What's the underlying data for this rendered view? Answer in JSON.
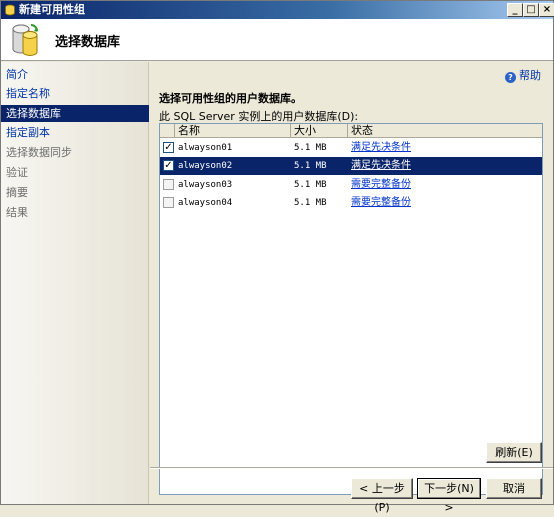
{
  "window": {
    "title": "新建可用性组"
  },
  "header": {
    "title": "选择数据库"
  },
  "nav": {
    "items": [
      {
        "label": "简介",
        "state": "link"
      },
      {
        "label": "指定名称",
        "state": "link"
      },
      {
        "label": "选择数据库",
        "state": "active"
      },
      {
        "label": "指定副本",
        "state": "link"
      },
      {
        "label": "选择数据同步",
        "state": "dim"
      },
      {
        "label": "验证",
        "state": "dim"
      },
      {
        "label": "摘要",
        "state": "dim"
      },
      {
        "label": "结果",
        "state": "dim"
      }
    ]
  },
  "main": {
    "help_label": "帮助",
    "section_title": "选择可用性组的用户数据库。",
    "list_label": "此 SQL Server 实例上的用户数据库(D):",
    "columns": {
      "name": "名称",
      "size": "大小",
      "status": "状态"
    },
    "rows": [
      {
        "name": "alwayson01",
        "size": "5.1 MB",
        "status": "满足先决条件",
        "checked": true,
        "selected": false
      },
      {
        "name": "alwayson02",
        "size": "5.1 MB",
        "status": "满足先决条件",
        "checked": true,
        "selected": true
      },
      {
        "name": "alwayson03",
        "size": "5.1 MB",
        "status": "需要完整备份",
        "checked": false,
        "selected": false
      },
      {
        "name": "alwayson04",
        "size": "5.1 MB",
        "status": "需要完整备份",
        "checked": false,
        "selected": false
      }
    ]
  },
  "buttons": {
    "refresh": "刷新(E)",
    "back": "< 上一步(P)",
    "next": "下一步(N) >",
    "cancel": "取消"
  },
  "colors": {
    "selection": "#0a246a",
    "link": "#0033aa"
  }
}
